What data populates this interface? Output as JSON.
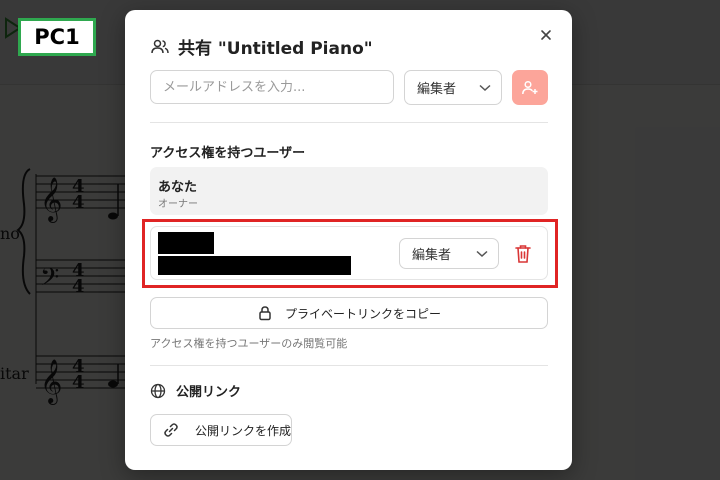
{
  "annotation": {
    "label": "PC1"
  },
  "background": {
    "score_label_piano": "no",
    "score_label_guitar": "itar"
  },
  "dialog": {
    "title": "共有 \"Untitled Piano\"",
    "email_placeholder": "メールアドレスを入力...",
    "invite_role": "編集者",
    "access_section_heading": "アクセス権を持つユーザー",
    "users": [
      {
        "name": "あなた",
        "role_label": "オーナー"
      },
      {
        "role": "編集者",
        "name_redacted": true,
        "email_redacted": true
      }
    ],
    "copy_private_link_label": "プライベートリンクをコピー",
    "private_link_note": "アクセス権を持つユーザーのみ閲覧可能",
    "public_link_heading": "公開リンク",
    "create_public_link_label": "公開リンクを作成"
  },
  "colors": {
    "accent_add_button": "#fca59a",
    "delete_icon": "#d93636",
    "highlight_box": "#e02424",
    "annotation_border": "#2fa84f"
  },
  "icons": {
    "title": "users-icon",
    "close": "close-icon",
    "dropdown": "chevron-down-icon",
    "add_user": "user-plus-icon",
    "delete": "trash-icon",
    "copy_link": "lock-icon",
    "public_link": "globe-icon",
    "create_link": "link-icon"
  }
}
